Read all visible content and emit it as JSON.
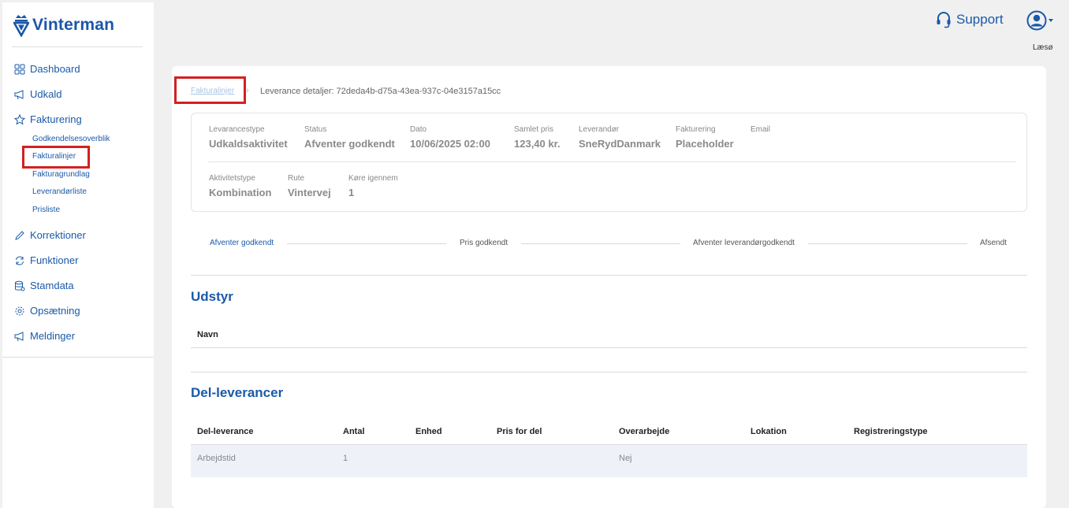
{
  "brand": {
    "name": "Vinterman",
    "logo_icon": "crown-v-icon",
    "accent": "#1a5aa8"
  },
  "sidebar": {
    "items": [
      {
        "label": "Dashboard",
        "icon": "grid-icon"
      },
      {
        "label": "Udkald",
        "icon": "megaphone-icon"
      },
      {
        "label": "Fakturering",
        "icon": "star-icon"
      },
      {
        "label": "Korrektioner",
        "icon": "pencil-icon"
      },
      {
        "label": "Funktioner",
        "icon": "refresh-icon"
      },
      {
        "label": "Stamdata",
        "icon": "database-icon"
      },
      {
        "label": "Opsætning",
        "icon": "gear-icon"
      },
      {
        "label": "Meldinger",
        "icon": "megaphone-icon"
      }
    ],
    "subitems": [
      {
        "label": "Godkendelsesoverblik"
      },
      {
        "label": "Fakturalinjer",
        "selected": true
      },
      {
        "label": "Fakturagrundlag"
      },
      {
        "label": "Leverandørliste"
      },
      {
        "label": "Prisliste"
      }
    ]
  },
  "header": {
    "support_label": "Support",
    "support_icon": "headset-icon",
    "user_icon": "user-circle-icon",
    "user_name": "Læsø"
  },
  "breadcrumb": {
    "link": "Fakturalinjer",
    "separator": "›",
    "current": "Leverance detaljer: 72deda4b-d75a-43ea-937c-04e3157a15cc"
  },
  "details": {
    "row1": [
      {
        "label": "Levarancestype",
        "value": "Udkaldsaktivitet"
      },
      {
        "label": "Status",
        "value": "Afventer godkendt"
      },
      {
        "label": "Dato",
        "value": "10/06/2025 02:00"
      },
      {
        "label": "Samlet pris",
        "value": "123,40 kr."
      },
      {
        "label": "Leverandør",
        "value": "SneRydDanmark"
      },
      {
        "label": "Fakturering",
        "value": "Placeholder"
      },
      {
        "label": "Email",
        "value": ""
      }
    ],
    "row2": [
      {
        "label": "Aktivitetstype",
        "value": "Kombination"
      },
      {
        "label": "Rute",
        "value": "Vintervej"
      },
      {
        "label": "Køre igennem",
        "value": "1"
      }
    ]
  },
  "progress": {
    "steps": [
      {
        "label": "Afventer godkendt",
        "active": true
      },
      {
        "label": "Pris godkendt",
        "active": false
      },
      {
        "label": "Afventer leverandørgodkendt",
        "active": false
      },
      {
        "label": "Afsendt",
        "active": false
      }
    ]
  },
  "udstyr": {
    "title": "Udstyr",
    "columns": [
      "Navn"
    ],
    "rows": []
  },
  "del_leverancer": {
    "title": "Del-leverancer",
    "columns": [
      "Del-leverance",
      "Antal",
      "Enhed",
      "Pris for del",
      "Overarbejde",
      "Lokation",
      "Registreringstype"
    ],
    "rows": [
      [
        "Arbejdstid",
        "1",
        "",
        "",
        "Nej",
        "",
        ""
      ]
    ]
  },
  "colors": {
    "highlight": "#d42020",
    "row_bg": "#eef2f8"
  }
}
